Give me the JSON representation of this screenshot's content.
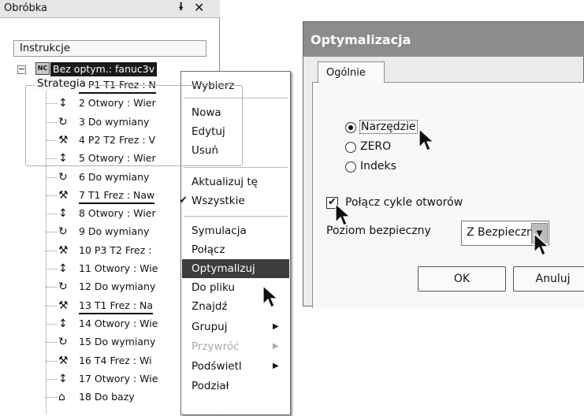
{
  "panel": {
    "title": "Obróbka",
    "pin_glyph": "ɨ",
    "close_glyph": "✕",
    "instructions_header": "Instrukcje",
    "collapse_glyph": "−",
    "root": {
      "icon_text": "NC",
      "label": "Bez optym.: fanuc3v"
    },
    "items": [
      {
        "label": "1 P1 T1 Frez : N",
        "icon": "cutter-tool-icon",
        "underlined": true
      },
      {
        "label": "2 Otwory : Wier",
        "icon": "drill-cycle-icon"
      },
      {
        "label": "3 Do wymiany",
        "icon": "tool-change-icon"
      },
      {
        "label": "4 P2 T2 Frez : V",
        "icon": "cutter-tool-icon"
      },
      {
        "label": "5 Otwory : Wier",
        "icon": "drill-cycle-icon"
      },
      {
        "label": "6 Do wymiany",
        "icon": "tool-change-icon"
      },
      {
        "label": "7 T1 Frez : Naw",
        "icon": "cutter-tool-icon",
        "underlined": true
      },
      {
        "label": "8 Otwory : Wier",
        "icon": "drill-cycle-icon"
      },
      {
        "label": "9 Do wymiany",
        "icon": "tool-change-icon"
      },
      {
        "label": "10 P3 T2 Frez :",
        "icon": "cutter-tool-icon"
      },
      {
        "label": "11 Otwory : Wie",
        "icon": "drill-cycle-icon"
      },
      {
        "label": "12 Do wymiany",
        "icon": "tool-change-icon"
      },
      {
        "label": "13 T1 Frez : Na",
        "icon": "cutter-tool-icon",
        "underlined": true
      },
      {
        "label": "14 Otwory : Wie",
        "icon": "drill-cycle-icon"
      },
      {
        "label": "15 Do wymiany",
        "icon": "tool-change-icon"
      },
      {
        "label": "16 T4 Frez : Wi",
        "icon": "cutter-tool-icon"
      },
      {
        "label": "17 Otwory : Wie",
        "icon": "drill-cycle-icon"
      },
      {
        "label": "18 Do bazy",
        "icon": "home-position-icon"
      }
    ]
  },
  "context_menu": {
    "items": [
      {
        "label": "Wybierz"
      },
      {
        "label": "Nowa"
      },
      {
        "label": "Edytuj"
      },
      {
        "label": "Usuń"
      },
      {
        "label": "Aktualizuj tę"
      },
      {
        "label": "Wszystkie",
        "checked": true
      },
      {
        "label": "Symulacja"
      },
      {
        "label": "Połącz"
      },
      {
        "label": "Optymalizuj",
        "selected": true
      },
      {
        "label": "Do pliku"
      },
      {
        "label": "Znajdź"
      },
      {
        "label": "Grupuj",
        "submenu": true
      },
      {
        "label": "Przywróć",
        "submenu": true,
        "disabled": true
      },
      {
        "label": "Podświetl",
        "submenu": true
      },
      {
        "label": "Podział"
      }
    ],
    "check_glyph": "✔",
    "submenu_glyph": "▶"
  },
  "dialog": {
    "title": "Optymalizacja",
    "tab": "Ogólnie",
    "strategy": {
      "title": "Strategia",
      "options": [
        {
          "label": "Narzędzie",
          "selected": true
        },
        {
          "label": "ZERO",
          "selected": false
        },
        {
          "label": "Indeks",
          "selected": false
        }
      ]
    },
    "combine_holes": {
      "label": "Połącz cykle otworów",
      "checked": true,
      "check_glyph": "✔"
    },
    "safety_level": {
      "label": "Poziom bezpieczny",
      "value": "Z Bezpieczny",
      "dropdown_glyph": "▼"
    },
    "buttons": {
      "ok": "OK",
      "cancel": "Anuluj"
    }
  },
  "colors": {
    "title_bar": "#8c8c8c",
    "menu_highlight": "#3c3c3c",
    "selection": "#1a1a1a"
  }
}
